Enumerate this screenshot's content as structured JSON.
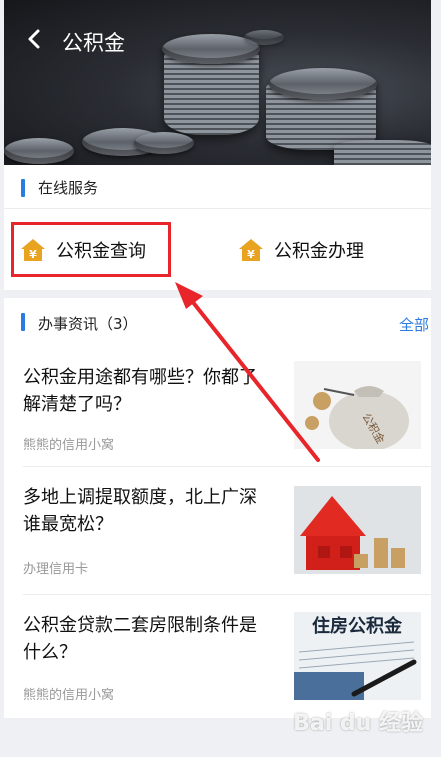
{
  "header": {
    "title": "公积金"
  },
  "online_services": {
    "section_title": "在线服务",
    "items": [
      {
        "label": "公积金查询",
        "icon": "house-yen-icon"
      },
      {
        "label": "公积金办理",
        "icon": "house-yen-icon"
      }
    ]
  },
  "news": {
    "section_title": "办事资讯（3）",
    "all_link": "全部",
    "items": [
      {
        "title": "公积金用途都有哪些？你都了解清楚了吗？",
        "source": "熊熊的信用小窝"
      },
      {
        "title": "多地上调提取额度，北上广深谁最宽松？",
        "source": "办理信用卡"
      },
      {
        "title": "公积金贷款二套房限制条件是什么？",
        "source": "熊熊的信用小窝"
      }
    ]
  },
  "images": {
    "bag_text": "公积金",
    "doc_text": "住房公积金"
  },
  "watermark": "Bai du 经验",
  "colors": {
    "accent": "#2b7be0",
    "highlight": "#e8252b",
    "icon": "#e8a320"
  }
}
